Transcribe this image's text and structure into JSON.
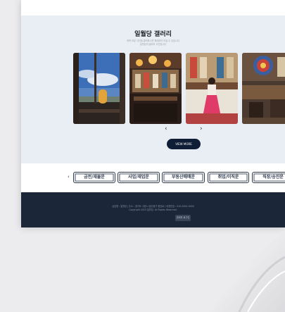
{
  "gallery": {
    "title": "일월당 갤러리",
    "subtitle_line1": "좌측 부분 사진을 클릭하시면 확대되어 보실 수 있습니다",
    "subtitle_line2": "일월당의 갤러리 사진입니다",
    "images": [
      {
        "name": "sky-window-view"
      },
      {
        "name": "shrine-altar"
      },
      {
        "name": "red-hanbok-shrine"
      },
      {
        "name": "shrine-interior"
      }
    ],
    "prev_arrow": "‹",
    "next_arrow": "›",
    "view_more_label": "VIEW MORE"
  },
  "categories": {
    "prev_arrow": "‹",
    "items": [
      {
        "label": "금전/재물운"
      },
      {
        "label": "사업/재업운"
      },
      {
        "label": "부동산매매운"
      },
      {
        "label": "취업/이직운"
      },
      {
        "label": "직장/승진운"
      }
    ]
  },
  "footer": {
    "info_line": "상호명 : 일월당 | 주소 : 경기도 고양시 일산동구 중앙로 | 대표번호 : 010-0000-0000",
    "copyright": "Copyright 2023 일월당. All Rights Reserved.",
    "admin_button": "관리자 로그인"
  },
  "colors": {
    "navy": "#0f1d36",
    "footer_bg": "#1b2639",
    "gallery_bg": "#e8eef4"
  }
}
